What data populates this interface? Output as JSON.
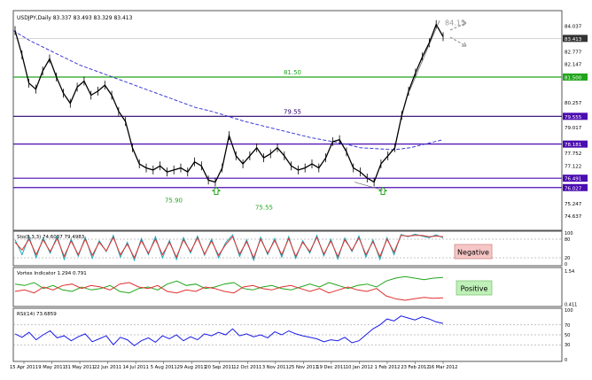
{
  "chart_data": {
    "type": "line",
    "title": "USDJPY,Daily  83.337 83.493 83.329 83.413",
    "x_labels": [
      "15 Apr 2011",
      "9 May 2011",
      "31 May 2011",
      "22 Jun 2011",
      "14 Jul 2011",
      "5 Aug 2011",
      "29 Aug 2011",
      "20 Sep 2011",
      "12 Oct 2011",
      "3 Nov 2011",
      "25 Nov 2011",
      "19 Dec 2011",
      "10 Jan 2012",
      "1 Feb 2012",
      "23 Feb 2012",
      "16 Mar 2012"
    ],
    "price_panel": {
      "ylim": [
        74.0,
        84.7
      ],
      "y_ticks": [
        "84.037",
        "83.413",
        "82.777",
        "82.147",
        "81.500",
        "80.257",
        "79.555",
        "79.017",
        "78.181",
        "77.752",
        "77.122",
        "76.491",
        "76.027",
        "75.247",
        "74.637"
      ],
      "highlighted_ticks": [
        "83.413",
        "81.500",
        "79.555",
        "78.181",
        "76.491",
        "76.027"
      ],
      "series": [
        {
          "name": "",
          "values": [
            83.8,
            82.6,
            81.2,
            80.9,
            81.8,
            82.4,
            81.5,
            80.7,
            80.2,
            81.0,
            81.3,
            80.6,
            80.8,
            81.1,
            80.6,
            79.8,
            79.3,
            78.0,
            77.2,
            77.0,
            76.9,
            77.1,
            76.8,
            76.9,
            77.0,
            76.8,
            77.3,
            77.1,
            76.4,
            76.3,
            77.0,
            78.6,
            77.6,
            77.2,
            77.6,
            78.0,
            77.5,
            77.7,
            78.0,
            77.6,
            77.1,
            76.9,
            77.0,
            77.2,
            77.0,
            77.5,
            78.3,
            78.4,
            77.8,
            77.0,
            76.8,
            76.5,
            76.3,
            77.2,
            77.6,
            78.0,
            79.6,
            80.8,
            81.7,
            82.5,
            83.2,
            84.1,
            83.5
          ]
        }
      ],
      "moving_average": [
        83.8,
        83.3,
        82.9,
        82.5,
        82.1,
        81.8,
        81.5,
        81.2,
        80.9,
        80.6,
        80.3,
        80.0,
        79.8,
        79.55,
        79.3,
        79.1,
        78.9,
        78.7,
        78.5,
        78.35,
        78.2,
        78.0,
        77.95,
        77.9,
        78.0,
        78.2,
        78.4
      ],
      "h_lines": [
        {
          "value": 81.5,
          "color": "#21a51c",
          "label": "81.50"
        },
        {
          "value": 79.555,
          "color": "#2a006a",
          "label": "79.55"
        },
        {
          "value": 78.181,
          "color": "#4b0cb0",
          "label": ""
        },
        {
          "value": 76.491,
          "color": "#4b0cb0",
          "label": ""
        },
        {
          "value": 76.027,
          "color": "#4b0cb0",
          "label": ""
        }
      ],
      "current_line": 83.413,
      "annotations": [
        "84.15",
        "75.90",
        "75.55"
      ]
    },
    "stoch_panel": {
      "title": "Sto(8,3,3) 74.6037 79.4983",
      "ylim": [
        0,
        100
      ],
      "y_ticks": [
        "100",
        "80",
        "20",
        "0"
      ],
      "series": [
        {
          "name": "",
          "color": "#1ba8b8",
          "values": [
            78,
            30,
            88,
            20,
            85,
            35,
            90,
            15,
            80,
            25,
            86,
            18,
            75,
            40,
            92,
            22,
            70,
            12,
            82,
            30,
            88,
            20,
            76,
            15,
            85,
            35,
            90,
            28,
            80,
            20,
            68,
            94,
            24,
            78,
            12,
            86,
            30,
            82,
            22,
            88,
            18,
            75,
            35,
            92,
            26,
            80,
            16,
            84,
            40,
            90,
            22,
            78,
            15,
            85,
            30,
            95,
            88,
            96,
            90,
            85,
            94,
            84
          ]
        },
        {
          "name": "",
          "color": "#e03030",
          "values": [
            70,
            45,
            80,
            30,
            78,
            40,
            82,
            25,
            74,
            30,
            80,
            28,
            70,
            42,
            86,
            30,
            64,
            20,
            75,
            35,
            80,
            30,
            70,
            22,
            78,
            40,
            84,
            32,
            74,
            28,
            62,
            88,
            32,
            72,
            20,
            80,
            35,
            76,
            30,
            82,
            25,
            70,
            40,
            86,
            32,
            74,
            24,
            78,
            44,
            84,
            30,
            72,
            24,
            80,
            38,
            92,
            90,
            92,
            92,
            88,
            90,
            88
          ]
        }
      ],
      "label": "Negative"
    },
    "vortex_panel": {
      "title": "Vortex Indicator 1.294 0.791",
      "ylim": [
        0.4,
        1.6
      ],
      "y_ticks": [
        "1.54",
        "0.411"
      ],
      "series": [
        {
          "name": "",
          "color": "#21a51c",
          "values": [
            1.1,
            1.05,
            1.15,
            0.95,
            1.05,
            0.9,
            0.85,
            1.0,
            0.9,
            0.95,
            1.05,
            0.85,
            0.8,
            0.95,
            1.0,
            0.9,
            1.1,
            1.2,
            1.05,
            1.1,
            0.95,
            1.0,
            1.1,
            1.15,
            0.95,
            0.9,
            1.0,
            1.05,
            0.95,
            0.9,
            1.0,
            1.1,
            1.0,
            1.15,
            1.05,
            0.95,
            1.05,
            1.1,
            1.0,
            1.2,
            1.3,
            1.35,
            1.3,
            1.25,
            1.3,
            1.32
          ]
        },
        {
          "name": "",
          "color": "#e03030",
          "values": [
            0.85,
            0.9,
            0.8,
            1.0,
            0.9,
            1.05,
            1.1,
            0.95,
            1.05,
            1.0,
            0.9,
            1.1,
            1.15,
            1.0,
            0.95,
            1.05,
            0.85,
            0.8,
            0.9,
            0.85,
            1.0,
            0.95,
            0.85,
            0.8,
            1.0,
            1.05,
            0.95,
            0.9,
            1.0,
            1.05,
            0.95,
            0.85,
            0.95,
            0.8,
            0.9,
            1.0,
            0.9,
            0.85,
            0.95,
            0.7,
            0.6,
            0.55,
            0.6,
            0.65,
            0.62,
            0.63
          ]
        }
      ],
      "label": "Positive"
    },
    "rsi_panel": {
      "title": "RSI(14) 73.6859",
      "ylim": [
        0,
        100
      ],
      "y_ticks": [
        "100",
        "70",
        "50",
        "30",
        "0"
      ],
      "series": [
        {
          "name": "",
          "color": "#1a1ae6",
          "values": [
            52,
            45,
            55,
            40,
            50,
            58,
            44,
            48,
            38,
            46,
            52,
            36,
            42,
            48,
            30,
            45,
            40,
            28,
            38,
            44,
            35,
            48,
            42,
            50,
            38,
            46,
            40,
            52,
            48,
            55,
            50,
            62,
            48,
            52,
            46,
            50,
            44,
            56,
            50,
            58,
            52,
            48,
            45,
            42,
            36,
            40,
            38,
            45,
            34,
            38,
            50,
            62,
            70,
            82,
            78,
            88,
            84,
            80,
            86,
            82,
            76,
            73
          ]
        }
      ]
    }
  }
}
